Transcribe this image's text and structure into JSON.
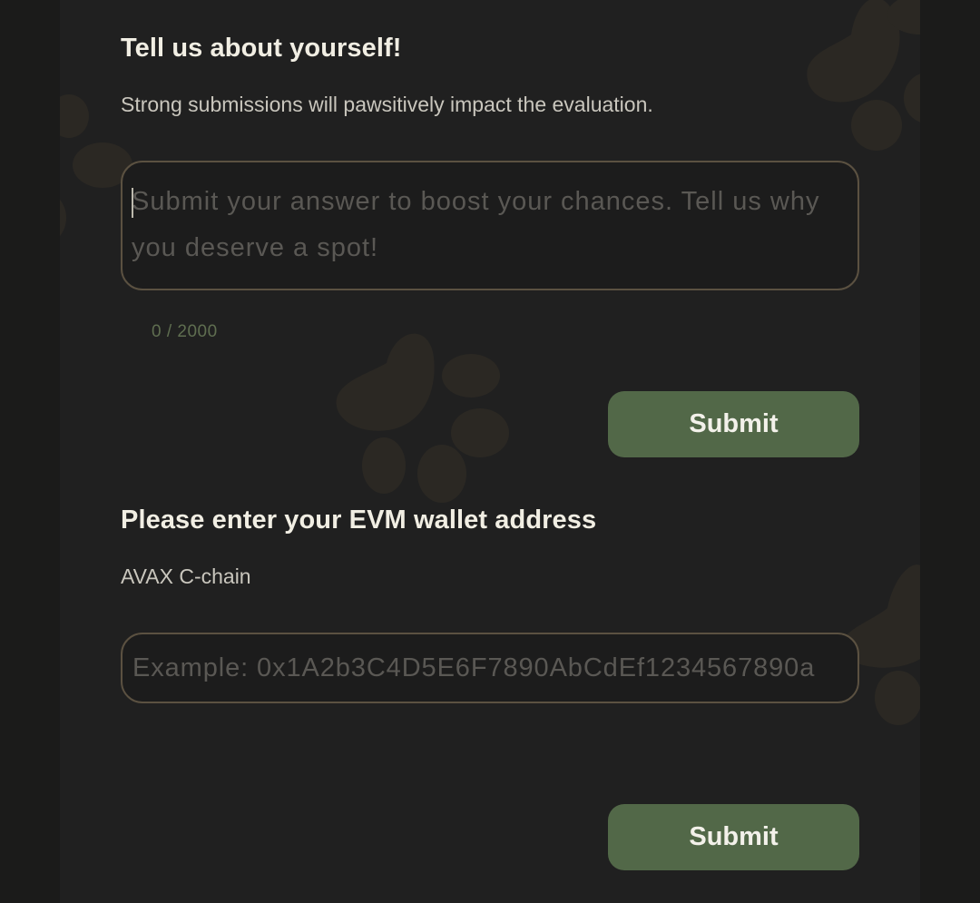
{
  "about": {
    "title": "Tell us about yourself!",
    "description": "Strong submissions will pawsitively impact the evaluation.",
    "answer_value": "",
    "answer_placeholder": "Submit your answer to boost your chances. Tell us why you deserve a spot!",
    "char_count": "0 / 2000",
    "submit_label": "Submit"
  },
  "wallet": {
    "title": "Please enter your EVM wallet address",
    "description": "AVAX C-chain",
    "address_value": "",
    "address_placeholder": "Example: 0x1A2b3C4D5E6F7890AbCdEf1234567890a",
    "submit_label": "Submit"
  },
  "colors": {
    "page_background": "#1b1b1a",
    "panel_background": "#202020",
    "paw_print": "#2b2823",
    "input_border": "#5b5141",
    "button_accent": "#526848",
    "counter_text": "#5f6e50"
  },
  "icons": {
    "background_decoration": "paw-print-icon"
  }
}
